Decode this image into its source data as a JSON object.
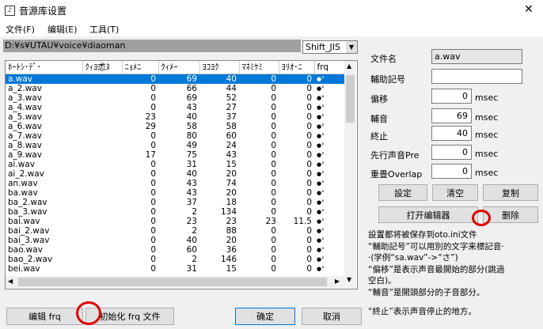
{
  "window": {
    "title": "音源库设置",
    "close": "✕"
  },
  "menu": [
    "文件(F)",
    "编辑(E)",
    "工具(T)"
  ],
  "path": "D:¥s¥UTAU¥voice¥diaoman",
  "encoding": "Shift_JIS",
  "table": {
    "headers": [
      "ﾎｰﾄｼ･ﾃﾞ･",
      "ｸｨﾖ怸ﾇ",
      "ﾆｮﾒﾆ",
      "ｸｨﾒｰ",
      "ﾖｺﾖｸ",
      "ﾏﾈﾐｹﾐ",
      "ﾖﾘｵ･ﾆ",
      "frq"
    ],
    "rows": [
      [
        "a.wav",
        "",
        "0",
        "69",
        "40",
        "0",
        "0",
        "●°"
      ],
      [
        "a_2.wav",
        "",
        "0",
        "66",
        "44",
        "0",
        "0",
        "●°"
      ],
      [
        "a_3.wav",
        "",
        "0",
        "69",
        "52",
        "0",
        "0",
        "●°"
      ],
      [
        "a_4.wav",
        "",
        "0",
        "43",
        "27",
        "0",
        "0",
        "●°"
      ],
      [
        "a_5.wav",
        "",
        "23",
        "40",
        "37",
        "0",
        "0",
        "●°"
      ],
      [
        "a_6.wav",
        "",
        "29",
        "58",
        "58",
        "0",
        "0",
        "●°"
      ],
      [
        "a_7.wav",
        "",
        "0",
        "80",
        "60",
        "0",
        "0",
        "●°"
      ],
      [
        "a_8.wav",
        "",
        "0",
        "49",
        "24",
        "0",
        "0",
        "●°"
      ],
      [
        "a_9.wav",
        "",
        "17",
        "75",
        "43",
        "0",
        "0",
        "●°"
      ],
      [
        "ai.wav",
        "",
        "0",
        "31",
        "15",
        "0",
        "0",
        "●°"
      ],
      [
        "ai_2.wav",
        "",
        "0",
        "40",
        "20",
        "0",
        "0",
        "●°"
      ],
      [
        "an.wav",
        "",
        "0",
        "43",
        "74",
        "0",
        "0",
        "●°"
      ],
      [
        "ba.wav",
        "",
        "0",
        "43",
        "20",
        "0",
        "0",
        "●°"
      ],
      [
        "ba_2.wav",
        "",
        "0",
        "37",
        "18",
        "0",
        "0",
        "●°"
      ],
      [
        "ba_3.wav",
        "",
        "0",
        "2",
        "134",
        "0",
        "0",
        "●°"
      ],
      [
        "bai.wav",
        "",
        "0",
        "23",
        "23",
        "23",
        "11.5",
        "●°"
      ],
      [
        "bai_2.wav",
        "",
        "0",
        "2",
        "88",
        "0",
        "0",
        "●°"
      ],
      [
        "bai_3.wav",
        "",
        "0",
        "40",
        "20",
        "0",
        "0",
        "●°"
      ],
      [
        "bao.wav",
        "",
        "0",
        "60",
        "36",
        "0",
        "0",
        "●°"
      ],
      [
        "bao_2.wav",
        "",
        "0",
        "2",
        "146",
        "0",
        "0",
        "●°"
      ],
      [
        "bei.wav",
        "",
        "0",
        "31",
        "15",
        "0",
        "0",
        "●°"
      ]
    ]
  },
  "form": {
    "filename_label": "文件名",
    "filename_value": "a.wav",
    "alias_label": "輔助記号",
    "alias_value": "",
    "offset_label": "偏移",
    "offset_value": "0",
    "consonant_label": "輔音",
    "consonant_value": "69",
    "cutoff_label": "終止",
    "cutoff_value": "40",
    "preutter_label": "先行声音Pre",
    "preutter_value": "0",
    "overlap_label": "重畳Overlap",
    "overlap_value": "0",
    "unit": "msec"
  },
  "buttons": {
    "set": "設定",
    "clear": "清空",
    "copy": "复制",
    "open_editor": "打开编辑器",
    "delete": "删除",
    "edit_frq": "编辑 frq",
    "init_frq": "初始化 frq 文件",
    "ok": "确定",
    "cancel": "取消"
  },
  "help": [
    "設置都将被保存到oto.ini文件",
    "“輔助記号”可以用別的文字来標記音·",
    "·(学例“sa.wav”->“さ”)",
    "“偏移”是表示声音最開始的部分(跳過",
    "空白)。",
    "“輔音”是開頭部分的子音部分。",
    "",
    "“終止”表示声音停止的地方。"
  ]
}
